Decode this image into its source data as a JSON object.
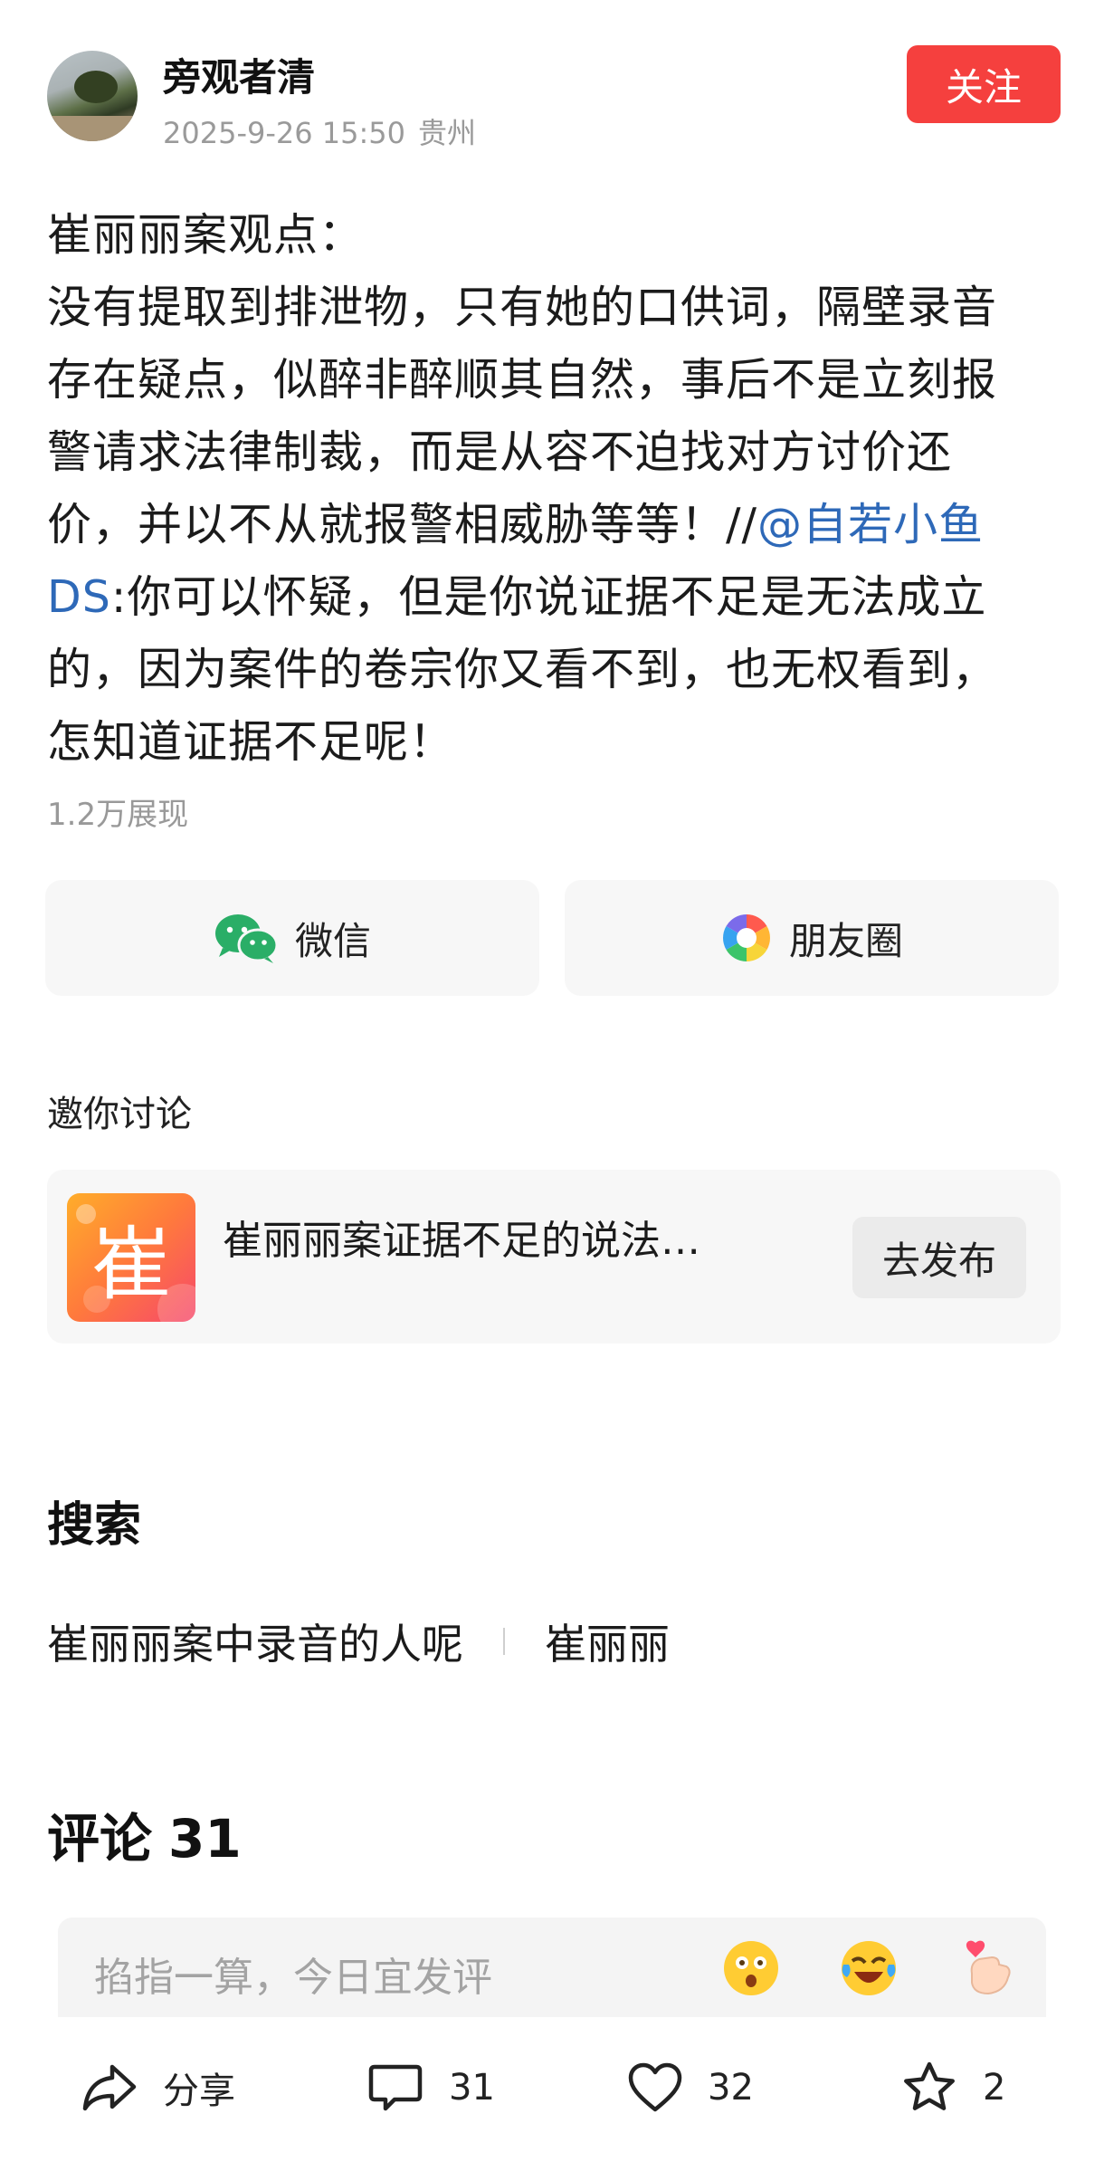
{
  "header": {
    "username": "旁观者清",
    "date": "2025-9-26 15:50",
    "location": "贵州",
    "follow_label": "关注"
  },
  "post": {
    "lines": [
      "崔丽丽案观点：",
      "没有提取到排泄物，只有她的口供词，隔壁录音",
      "存在疑点，似醉非醉顺其自然，事后不是立刻报",
      "警请求法律制裁，而是从容不迫找对方讨价还",
      "价，并以不从就报警相威胁等等！//"
    ],
    "mention_part1": "@自若小鱼",
    "mention_part2": "DS",
    "line6_rest": ":你可以怀疑，但是你说证据不足是无法成立",
    "line7": "的，因为案件的卷宗你又看不到，也无权看到，",
    "line8": "怎知道证据不足呢！",
    "views": "1.2万展现"
  },
  "share": {
    "wechat_label": "微信",
    "moments_label": "朋友圈"
  },
  "invite": {
    "title": "邀你讨论",
    "topic_icon_char": "崔",
    "topic_title": "崔丽丽案证据不足的说法…",
    "publish_label": "去发布"
  },
  "search": {
    "title": "搜索",
    "items": [
      "崔丽丽案中录音的人呢",
      "崔丽丽"
    ]
  },
  "comments": {
    "title": "评论",
    "count": "31",
    "placeholder": "掐指一算，今日宜发评"
  },
  "bottom_bar": {
    "share_label": "分享",
    "comment_count": "31",
    "like_count": "32",
    "favorite_count": "2"
  },
  "colors": {
    "accent_red": "#f5403e",
    "mention_blue": "#2e69b8",
    "wechat_green": "#2aae67"
  }
}
